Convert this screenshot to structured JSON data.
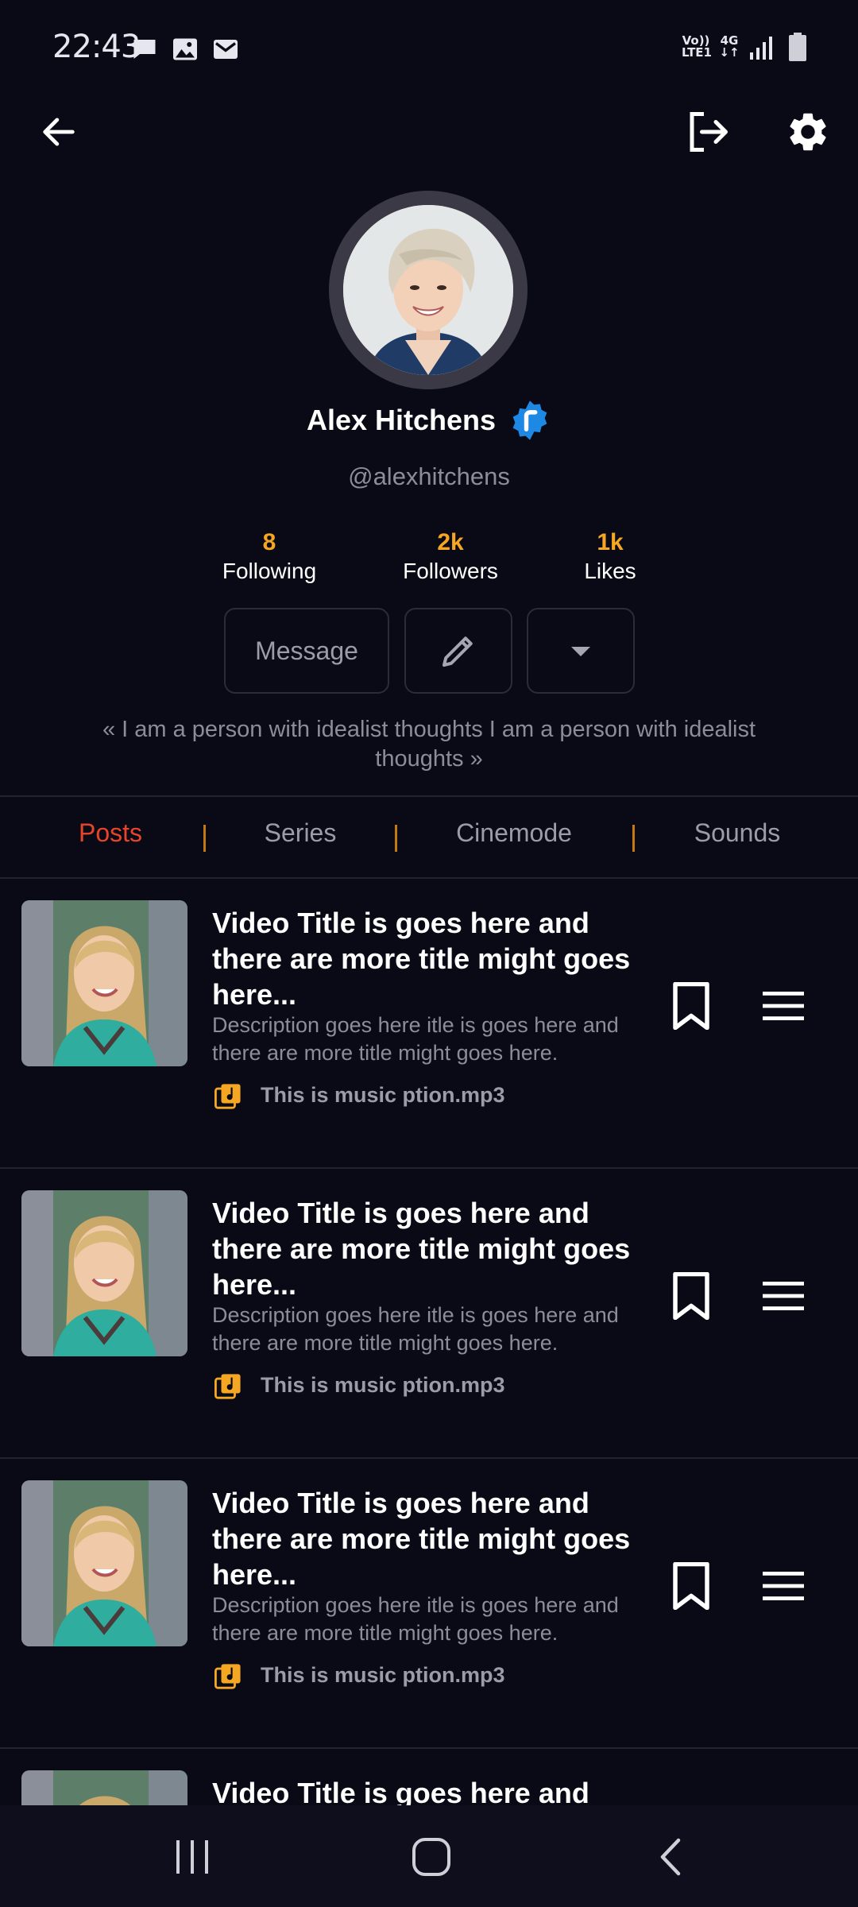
{
  "status_bar": {
    "time": "22:43",
    "notification_icons": [
      "chat-bubble-icon",
      "image-icon",
      "mail-icon"
    ],
    "network": {
      "volte": "Vo))",
      "lte": "LTE1",
      "gen": "4G"
    },
    "right_icons": [
      "signal-icon",
      "battery-icon"
    ]
  },
  "top_bar": {
    "icons": [
      "arrow-left-icon",
      "logout-icon",
      "gear-icon"
    ]
  },
  "profile": {
    "name": "Alex Hitchens",
    "verified_icon": "verified-badge-icon",
    "handle": "@alexhitchens",
    "stats": [
      {
        "value": "8",
        "label": "Following"
      },
      {
        "value": "2k",
        "label": "Followers"
      },
      {
        "value": "1k",
        "label": "Likes"
      }
    ],
    "actions": {
      "message_label": "Message",
      "edit_icon": "pencil-icon",
      "more_icon": "caret-down-icon"
    },
    "bio": "« I am a person with idealist thoughts I am a person with idealist thoughts  »"
  },
  "tabs": [
    {
      "label": "Posts",
      "active": true
    },
    {
      "label": "Series",
      "active": false
    },
    {
      "label": "Cinemode",
      "active": false
    },
    {
      "label": "Sounds",
      "active": false
    }
  ],
  "posts": [
    {
      "title": "Video Title is goes here and there are more title might goes here...",
      "description": "Description goes here itle is goes here and there are more title might goes here.",
      "music": "This is music ption.mp3"
    },
    {
      "title": "Video Title is goes here and there are more title might goes here...",
      "description": "Description goes here itle is goes here and there are more title might goes here.",
      "music": "This is music ption.mp3"
    },
    {
      "title": "Video Title is goes here and there are more title might goes here...",
      "description": "Description goes here itle is goes here and there are more title might goes here.",
      "music": "This is music ption.mp3"
    },
    {
      "title": "Video Title is goes here and"
    }
  ],
  "nav_bar": {
    "icons": [
      "recents-icon",
      "home-icon",
      "back-icon"
    ]
  },
  "colors": {
    "background": "#0a0a16",
    "accent_orange": "#f5a623",
    "active_tab": "#e8442a",
    "muted_text": "#8d8c99",
    "verified_blue": "#1e88e5",
    "music_icon": "#f5a623"
  }
}
